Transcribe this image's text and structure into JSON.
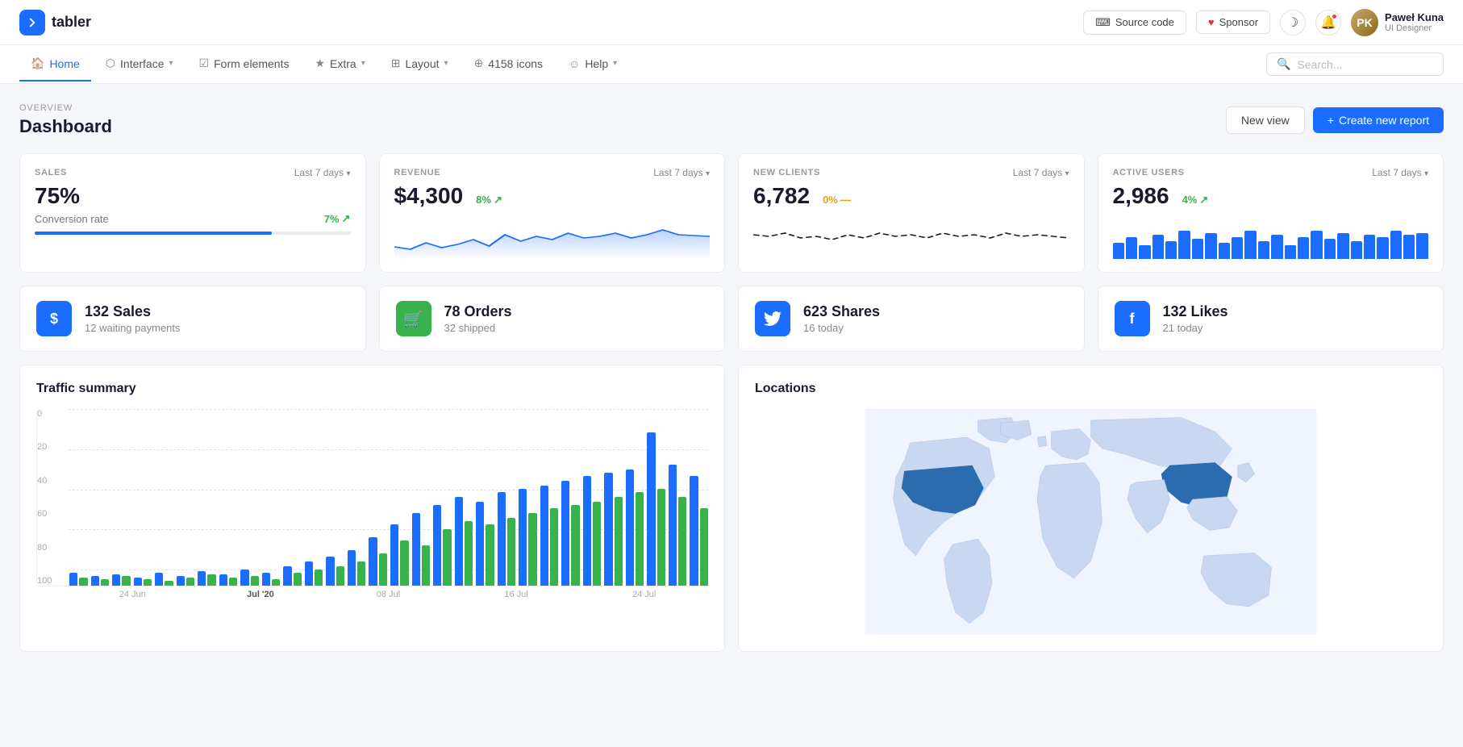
{
  "header": {
    "logo_text": "tabler",
    "source_code_label": "Source code",
    "sponsor_label": "Sponsor",
    "user_name": "Paweł Kuna",
    "user_role": "UI Designer"
  },
  "nav": {
    "items": [
      {
        "label": "Home",
        "icon": "🏠",
        "active": true
      },
      {
        "label": "Interface",
        "icon": "⬡",
        "active": false,
        "has_dropdown": true
      },
      {
        "label": "Form elements",
        "icon": "☑",
        "active": false
      },
      {
        "label": "Extra",
        "icon": "★",
        "active": false,
        "has_dropdown": true
      },
      {
        "label": "Layout",
        "icon": "⊞",
        "active": false,
        "has_dropdown": true
      },
      {
        "label": "4158 icons",
        "icon": "⊕",
        "active": false
      },
      {
        "label": "Help",
        "icon": "☺",
        "active": false,
        "has_dropdown": true
      }
    ],
    "search_placeholder": "Search..."
  },
  "page": {
    "breadcrumb": "OVERVIEW",
    "title": "Dashboard",
    "new_view_label": "New view",
    "create_report_label": "Create new report"
  },
  "stats": [
    {
      "label": "SALES",
      "period": "Last 7 days",
      "value": "75%",
      "sub_label": "Conversion rate",
      "sub_value": "7%",
      "badge_color": "green",
      "progress": 75
    },
    {
      "label": "REVENUE",
      "period": "Last 7 days",
      "value": "$4,300",
      "badge": "8%",
      "badge_color": "green",
      "has_chart": true
    },
    {
      "label": "NEW CLIENTS",
      "period": "Last 7 days",
      "value": "6,782",
      "badge": "0%",
      "badge_color": "yellow",
      "has_chart": true
    },
    {
      "label": "ACTIVE USERS",
      "period": "Last 7 days",
      "value": "2,986",
      "badge": "4%",
      "badge_color": "green",
      "has_bars": true
    }
  ],
  "metrics": [
    {
      "label": "132 Sales",
      "sub": "12 waiting payments",
      "icon": "$",
      "bg_color": "#1a6dff",
      "icon_color": "#fff"
    },
    {
      "label": "78 Orders",
      "sub": "32 shipped",
      "icon": "🛒",
      "bg_color": "#37b24d",
      "icon_color": "#fff"
    },
    {
      "label": "623 Shares",
      "sub": "16 today",
      "icon": "🐦",
      "bg_color": "#1a6dff",
      "icon_color": "#fff"
    },
    {
      "label": "132 Likes",
      "sub": "21 today",
      "icon": "f",
      "bg_color": "#1a6dff",
      "icon_color": "#fff"
    }
  ],
  "traffic": {
    "title": "Traffic summary",
    "y_labels": [
      "0",
      "20",
      "40",
      "60",
      "80",
      "100"
    ],
    "x_labels": [
      "24 Jun",
      "Jul '20",
      "08 Jul",
      "16 Jul",
      "24 Jul"
    ],
    "bars": [
      {
        "blue": 8,
        "green": 5
      },
      {
        "blue": 6,
        "green": 4
      },
      {
        "blue": 7,
        "green": 6
      },
      {
        "blue": 5,
        "green": 4
      },
      {
        "blue": 8,
        "green": 3
      },
      {
        "blue": 6,
        "green": 5
      },
      {
        "blue": 9,
        "green": 7
      },
      {
        "blue": 7,
        "green": 5
      },
      {
        "blue": 10,
        "green": 6
      },
      {
        "blue": 8,
        "green": 4
      },
      {
        "blue": 12,
        "green": 8
      },
      {
        "blue": 15,
        "green": 10
      },
      {
        "blue": 18,
        "green": 12
      },
      {
        "blue": 22,
        "green": 15
      },
      {
        "blue": 30,
        "green": 20
      },
      {
        "blue": 38,
        "green": 28
      },
      {
        "blue": 45,
        "green": 25
      },
      {
        "blue": 50,
        "green": 35
      },
      {
        "blue": 55,
        "green": 40
      },
      {
        "blue": 52,
        "green": 38
      },
      {
        "blue": 58,
        "green": 42
      },
      {
        "blue": 60,
        "green": 45
      },
      {
        "blue": 62,
        "green": 48
      },
      {
        "blue": 65,
        "green": 50
      },
      {
        "blue": 68,
        "green": 52
      },
      {
        "blue": 70,
        "green": 55
      },
      {
        "blue": 72,
        "green": 58
      },
      {
        "blue": 95,
        "green": 60
      },
      {
        "blue": 75,
        "green": 55
      },
      {
        "blue": 68,
        "green": 48
      }
    ]
  },
  "locations": {
    "title": "Locations"
  },
  "revenue_sparkline": [
    30,
    25,
    35,
    28,
    32,
    38,
    30,
    42,
    36,
    40,
    35,
    38,
    32,
    36,
    40,
    38,
    35,
    42,
    38,
    36
  ],
  "clients_sparkline": [
    40,
    35,
    42,
    38,
    36,
    32,
    38,
    35,
    40,
    42,
    38,
    35,
    40,
    38,
    42,
    36,
    38,
    35,
    40,
    38
  ],
  "bar_mini_heights": [
    40,
    55,
    35,
    60,
    45,
    70,
    50,
    65,
    40,
    55,
    70,
    45,
    60,
    35,
    55,
    70,
    50,
    65,
    45,
    60,
    55,
    70,
    60,
    65
  ]
}
